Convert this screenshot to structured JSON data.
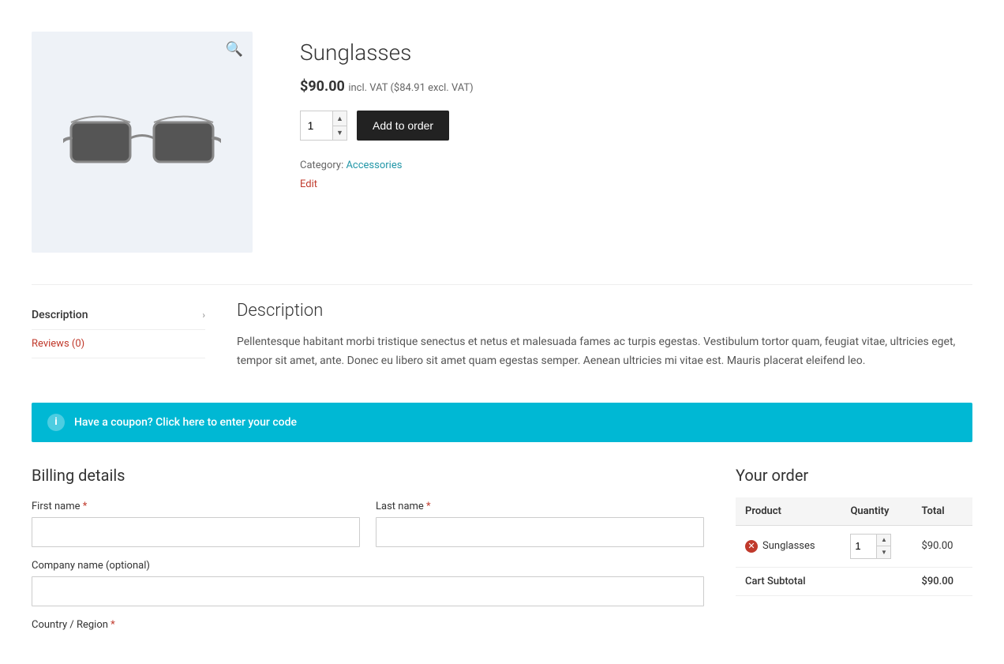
{
  "product": {
    "title": "Sunglasses",
    "price": "$90.00",
    "vat_info": "incl. VAT ($84.91 excl. VAT)",
    "quantity": "1",
    "add_to_order_label": "Add to order",
    "category_label": "Category:",
    "category_name": "Accessories",
    "edit_label": "Edit"
  },
  "tabs": {
    "items": [
      {
        "label": "Description",
        "active": true
      },
      {
        "label": "Reviews (0)",
        "active": false
      }
    ],
    "active_content": {
      "title": "Description",
      "text": "Pellentesque habitant morbi tristique senectus et netus et malesuada fames ac turpis egestas. Vestibulum tortor quam, feugiat vitae, ultricies eget, tempor sit amet, ante. Donec eu libero sit amet quam egestas semper. Aenean ultricies mi vitae est. Mauris placerat eleifend leo."
    }
  },
  "coupon": {
    "text": "Have a coupon? Click here to enter your code"
  },
  "billing": {
    "title": "Billing details",
    "fields": {
      "first_name_label": "First name",
      "last_name_label": "Last name",
      "company_label": "Company name (optional)",
      "country_label": "Country / Region"
    }
  },
  "order": {
    "title": "Your order",
    "columns": {
      "product": "Product",
      "quantity": "Quantity",
      "total": "Total"
    },
    "items": [
      {
        "name": "Sunglasses",
        "quantity": "1",
        "total": "$90.00"
      }
    ],
    "cart_subtotal_label": "Cart Subtotal",
    "cart_subtotal_value": "$90.00"
  }
}
